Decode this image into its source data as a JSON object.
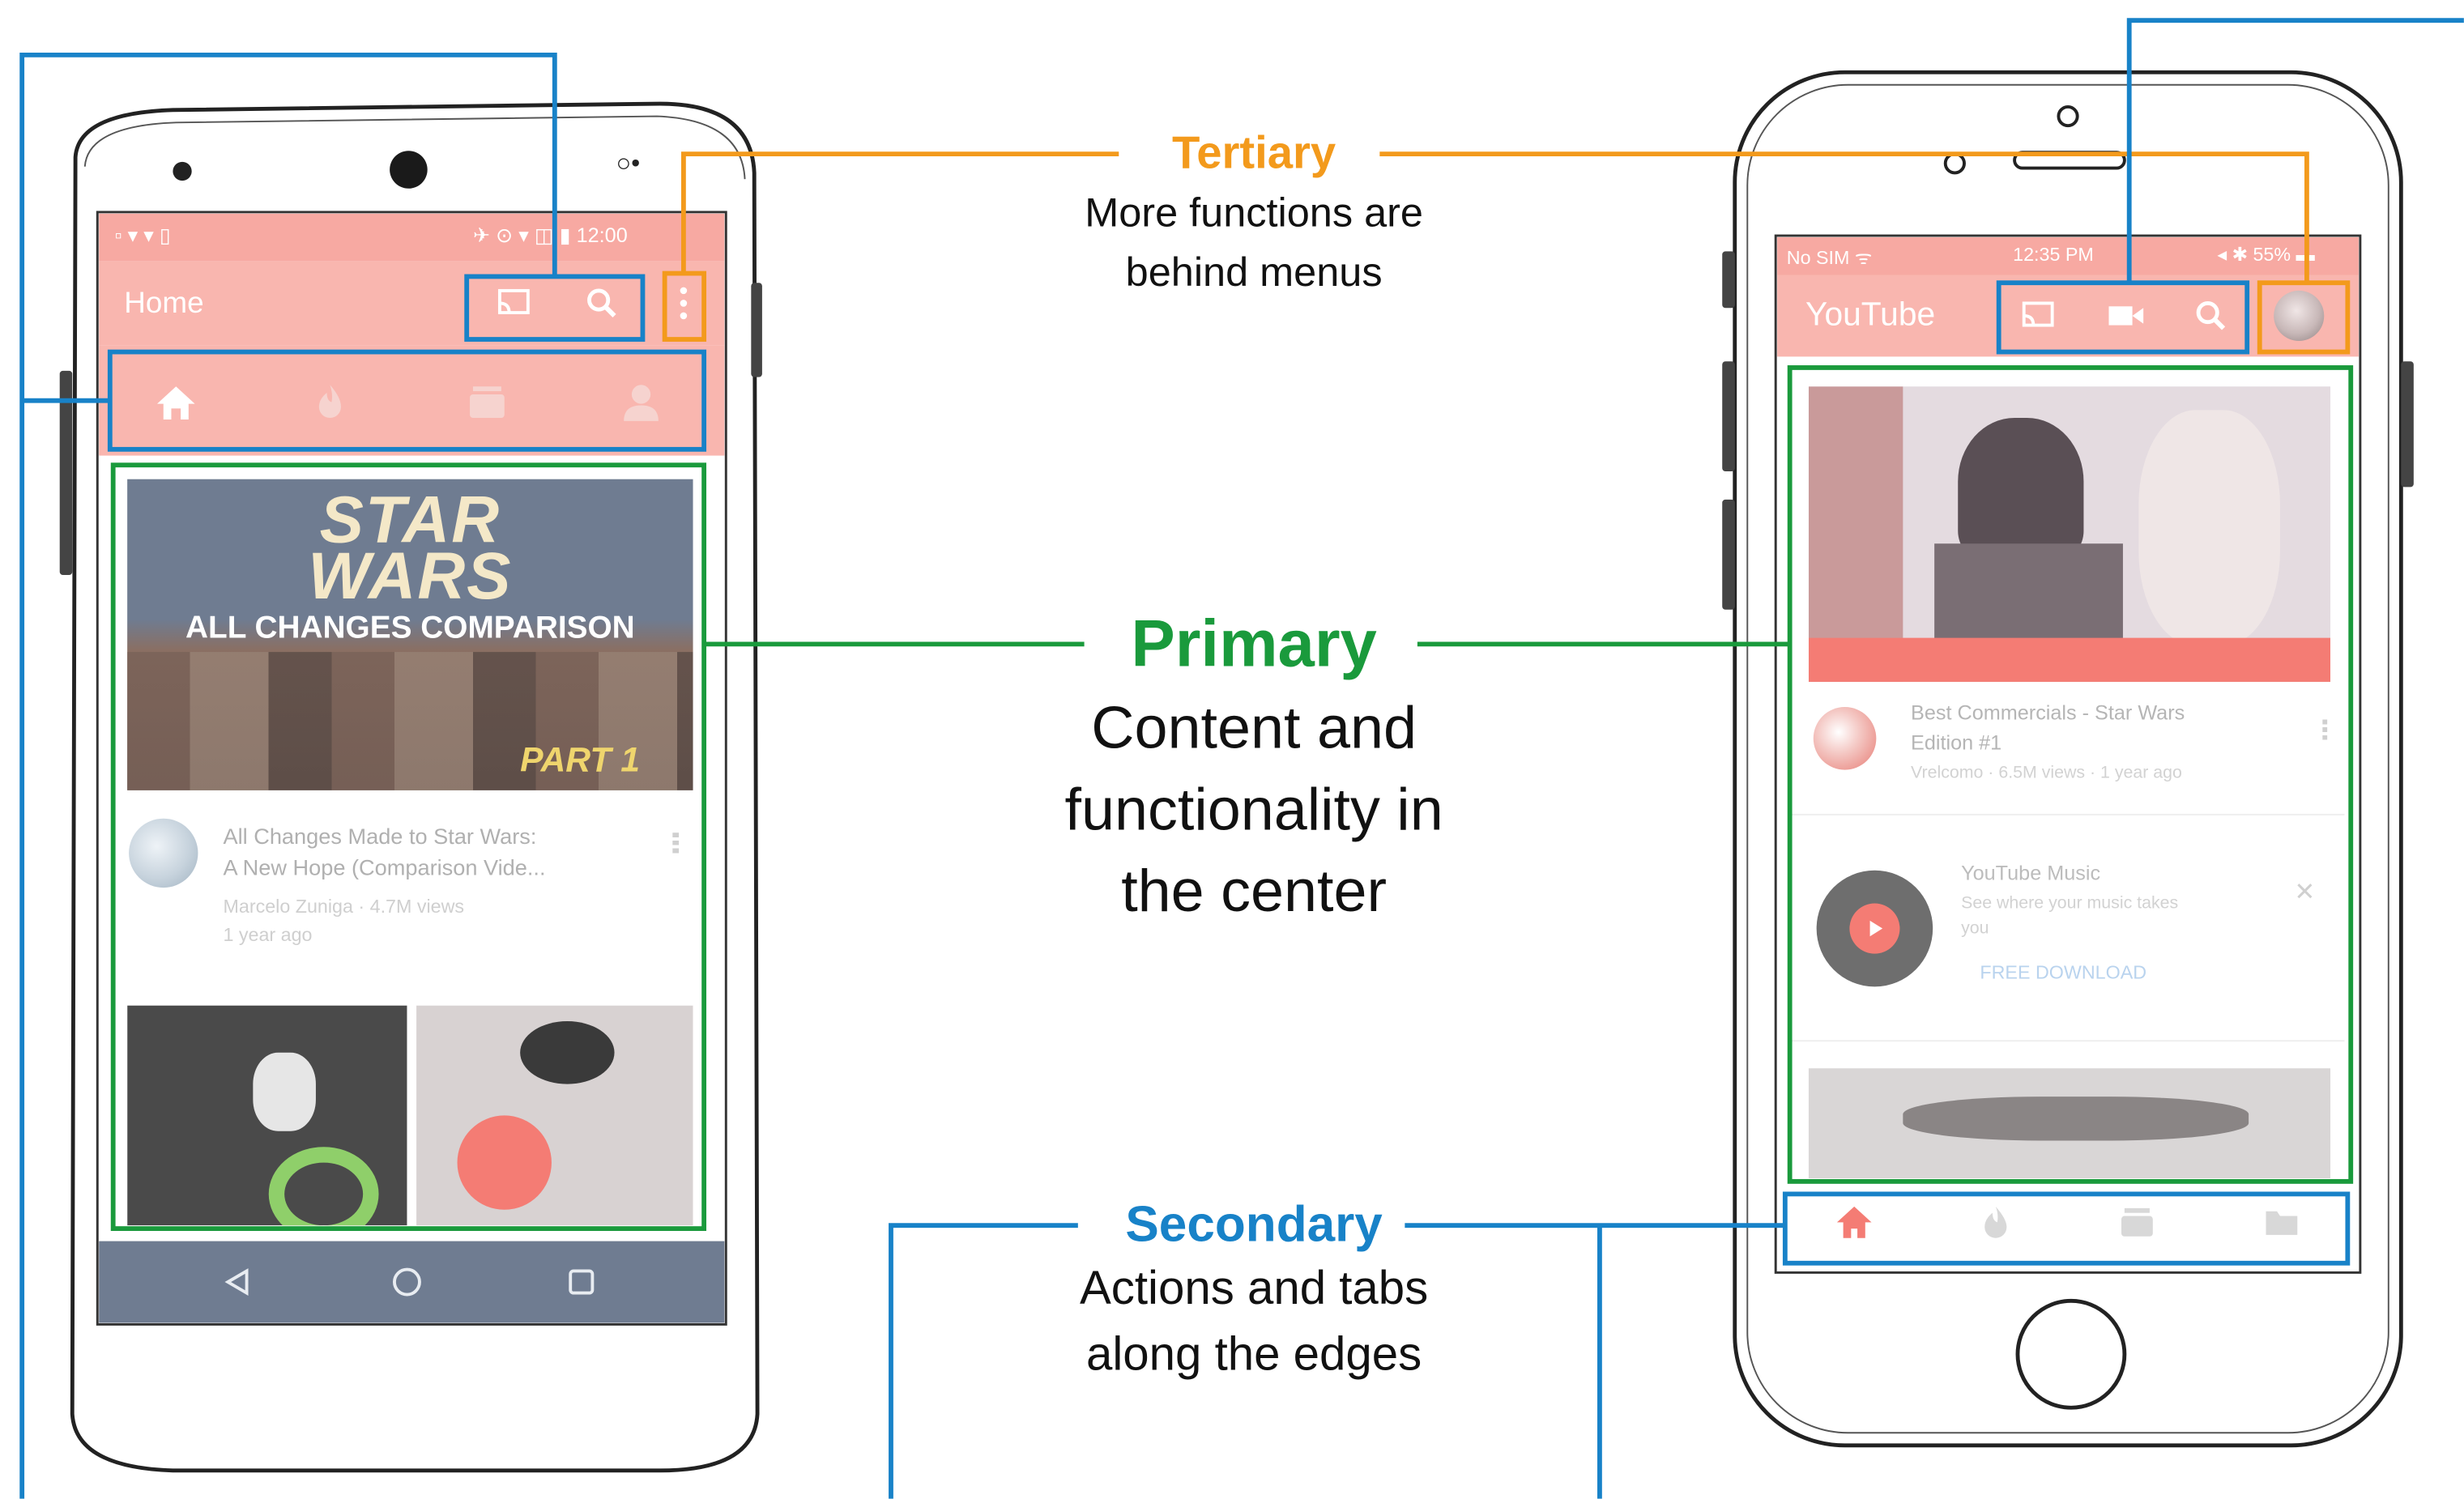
{
  "colors": {
    "tertiary": "#F39A1C",
    "primary": "#1A9A3C",
    "secondary": "#1882C8",
    "app_bar": "#F9B6AF",
    "thumb_tint": "#6F7C91"
  },
  "annotations": {
    "tertiary": {
      "heading": "Tertiary",
      "line1": "More functions are",
      "line2": "behind menus"
    },
    "primary": {
      "heading": "Primary",
      "line1": "Content and",
      "line2": "functionality in",
      "line3": "the center"
    },
    "secondary": {
      "heading": "Secondary",
      "line1": "Actions and tabs",
      "line2": "along the edges"
    }
  },
  "android": {
    "title": "Home",
    "status_left": "▫ ▾ ▾ ▯",
    "status_right": "✈ ⊙ ▾ ◫ ▮ 12:00",
    "video1": {
      "thumb_line1": "STAR",
      "thumb_line2": "WARS",
      "thumb_line3": "ALL CHANGES COMPARISON",
      "thumb_badge": "PART 1",
      "title_line1": "All Changes Made to Star Wars:",
      "title_line2": "A New Hope (Comparison Vide...",
      "meta_line1": "Marcelo Zuniga · 4.7M views",
      "meta_line2": "1 year ago"
    },
    "tab_icons": [
      "home-icon",
      "trending-icon",
      "subscriptions-icon",
      "account-icon"
    ],
    "nav_icons": [
      "back-icon",
      "home-circle-icon",
      "recents-icon"
    ]
  },
  "iphone": {
    "title": "YouTube",
    "status_left": "No SIM ᯤ",
    "status_center": "12:35 PM",
    "status_right": "◂ ✱ 55% ▬",
    "video1": {
      "title_line1": "Best Commercials - Star Wars",
      "title_line2": "Edition #1",
      "meta": "Vrelcomo · 6.5M views · 1 year ago"
    },
    "promo": {
      "title": "YouTube Music",
      "desc_line1": "See where your music takes",
      "desc_line2": "you",
      "cta": "FREE DOWNLOAD",
      "close": "✕"
    },
    "tab_icons": [
      "home-icon",
      "trending-icon",
      "subscriptions-icon",
      "library-icon"
    ]
  }
}
